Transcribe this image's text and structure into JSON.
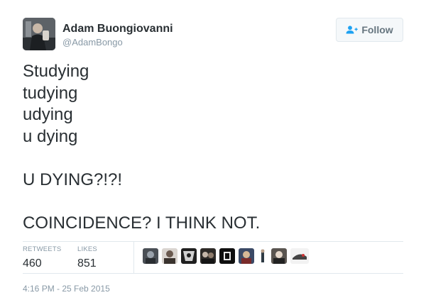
{
  "author": {
    "display_name": "Adam Buongiovanni",
    "handle": "@AdamBongo"
  },
  "follow_button": {
    "label": "Follow",
    "icon": "add-user-icon"
  },
  "tweet": {
    "lines": [
      "Studying",
      "tudying",
      "udying",
      "u dying",
      "",
      "U DYING?!?!",
      "",
      "COINCIDENCE? I THINK NOT."
    ]
  },
  "stats": {
    "retweets_label": "RETWEETS",
    "retweets_value": "460",
    "likes_label": "LIKES",
    "likes_value": "851"
  },
  "likers": [
    "liker-avatar",
    "liker-avatar",
    "liker-avatar",
    "liker-avatar",
    "liker-avatar",
    "liker-avatar",
    "liker-avatar",
    "liker-avatar",
    "liker-avatar"
  ],
  "timestamp": "4:16 PM - 25 Feb 2015",
  "colors": {
    "text": "#292f33",
    "muted": "#8899a6",
    "border": "#e1e8ed",
    "button_bg": "#f5f8fa",
    "button_text": "#66757f",
    "follow_icon": "#1da1f2"
  }
}
